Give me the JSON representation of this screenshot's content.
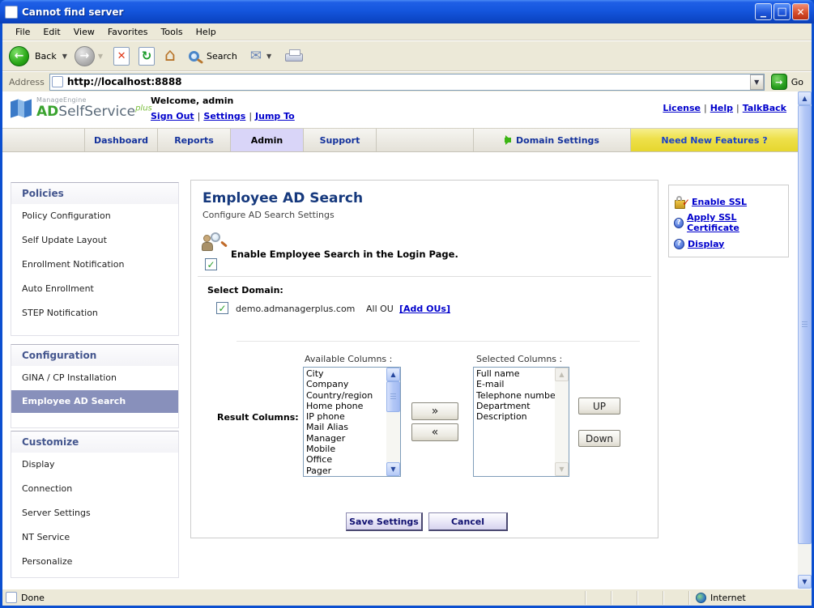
{
  "window": {
    "title": "Cannot find server"
  },
  "menu": {
    "items": [
      "File",
      "Edit",
      "View",
      "Favorites",
      "Tools",
      "Help"
    ]
  },
  "toolbar": {
    "back": "Back",
    "search": "Search"
  },
  "address": {
    "label": "Address",
    "url": "http://localhost:8888",
    "go": "Go"
  },
  "header": {
    "logo": {
      "company": "ManageEngine",
      "ad": "AD",
      "product": "SelfService",
      "plus": "plus"
    },
    "welcome": "Welcome, admin",
    "sep": "|",
    "session_links": [
      "Sign Out",
      "Settings",
      "Jump To"
    ],
    "top_links": [
      "License",
      "Help",
      "TalkBack"
    ]
  },
  "tabs": {
    "items": [
      {
        "label": "Dashboard"
      },
      {
        "label": "Reports"
      },
      {
        "label": "Admin"
      },
      {
        "label": "Support"
      }
    ],
    "active": "Admin",
    "domain_settings": "Domain Settings",
    "need_features": "Need New Features ?"
  },
  "sidebar": {
    "sections": [
      {
        "title": "Policies",
        "items": [
          "Policy Configuration",
          "Self Update Layout",
          "Enrollment Notification",
          "Auto Enrollment",
          "STEP Notification"
        ]
      },
      {
        "title": "Configuration",
        "items": [
          "GINA / CP Installation",
          "Employee AD Search"
        ],
        "active": "Employee AD Search"
      },
      {
        "title": "Customize",
        "items": [
          "Display",
          "Connection",
          "Server Settings",
          "NT Service",
          "Personalize"
        ]
      }
    ]
  },
  "main": {
    "title": "Employee AD Search",
    "subtitle": "Configure AD Search Settings",
    "enable_label": "Enable Employee Search in the Login Page.",
    "select_domain": "Select Domain:",
    "domain_name": "demo.admanagerplus.com",
    "ou_label": "All OU",
    "add_ous": "[Add OUs]",
    "result_columns": "Result Columns:",
    "available_label": "Available Columns :",
    "available_items": [
      "City",
      "Company",
      "Country/region",
      "Home phone",
      "IP phone",
      "Mail Alias",
      "Manager",
      "Mobile",
      "Office",
      "Pager"
    ],
    "selected_label": "Selected Columns :",
    "selected_items": [
      "Full name",
      "E-mail",
      "Telephone number",
      "Department",
      "Description"
    ],
    "move_right": "»",
    "move_left": "«",
    "up": "UP",
    "down": "Down",
    "save": "Save Settings",
    "cancel": "Cancel"
  },
  "quick_links": {
    "items": [
      "Enable SSL",
      "Apply SSL Certificate",
      "Display"
    ]
  },
  "status": {
    "left": "Done",
    "right": "Internet"
  },
  "colors": {
    "titlebar": "#1456dd",
    "tab_active_bg": "#d9d5f8",
    "need_features_bg": "#eee04a",
    "active_item_bg": "#8890bb",
    "link": "#0000cc",
    "heading": "#16397d",
    "logo_green": "#3aa32f"
  }
}
